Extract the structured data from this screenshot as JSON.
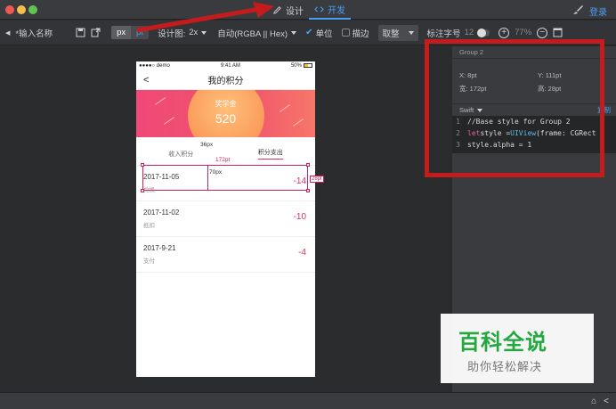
{
  "titlebar": {
    "tab_design": "设计",
    "tab_develop": "开发",
    "login": "登录"
  },
  "toolbar": {
    "name_placeholder": "*输入名称",
    "unit_px": "px",
    "unit_pt": "pt",
    "design_label": "设计图:",
    "design_scale": "2x",
    "color_mode": "自动(RGBA || Hex)",
    "unit_check": "单位",
    "stroke": "描边",
    "pick": "取整",
    "font_label": "标注字号",
    "font_size": "12",
    "zoom": "77%"
  },
  "phone": {
    "status_left": "●●●●○ demo",
    "status_time": "9:41 AM",
    "status_right": "50%",
    "nav_title": "我的积分",
    "nav_back": "<",
    "banner_label": "奖学金",
    "banner_value": "520",
    "tab_left": "收入积分",
    "tab_right": "积分支出",
    "records": [
      {
        "date": "2017-11-05",
        "sub": "兑换",
        "value": "-14"
      },
      {
        "date": "2017-11-02",
        "sub": "抵扣",
        "value": "-10"
      },
      {
        "date": "2017-9-21",
        "sub": "支付",
        "value": "-4"
      }
    ]
  },
  "measurements": {
    "m36": "36px",
    "m172": "172pt",
    "m70": "70px",
    "m28": "28pt"
  },
  "inspector": {
    "group_name": "Group 2",
    "x": "X: 8pt",
    "y": "Y:   111pt",
    "w": "宽:  172pt",
    "h": "高:   28pt",
    "lang": "Swift",
    "copy": "复制",
    "code": [
      {
        "n": "1",
        "text": "//Base style for Group 2"
      },
      {
        "n": "2",
        "kw": "let",
        "text": " style = ",
        "ty": "UIView",
        "rest": "(frame: CGRect"
      },
      {
        "n": "3",
        "text": "style.alpha = 1"
      }
    ]
  },
  "watermark": {
    "main": "百科全说",
    "sub": "助你轻松解决"
  },
  "colors": {
    "accent": "#4a9ef2",
    "annotation_red": "#c41c1c",
    "pink": "#e0305a"
  }
}
